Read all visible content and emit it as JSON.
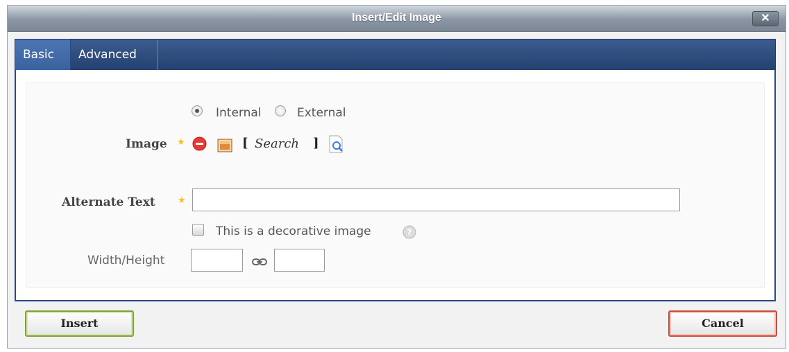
{
  "dialog": {
    "title": "Insert/Edit Image",
    "close_label": "✕"
  },
  "tabs": [
    {
      "label": "Basic",
      "active": true
    },
    {
      "label": "Advanced",
      "active": false
    }
  ],
  "form": {
    "source": {
      "options": [
        {
          "label": "Internal",
          "checked": true
        },
        {
          "label": "External",
          "checked": false
        }
      ]
    },
    "image": {
      "label": "Image",
      "required_mark": "★",
      "bracket_open": "[",
      "search_link": "Search",
      "bracket_close": "]"
    },
    "alt_text": {
      "label": "Alternate Text",
      "required_mark": "★",
      "value": ""
    },
    "decorative": {
      "label": "This is a decorative image",
      "checked": false
    },
    "dimensions": {
      "label": "Width/Height",
      "width_value": "",
      "height_value": ""
    }
  },
  "buttons": {
    "insert_label": "Insert",
    "cancel_label": "Cancel"
  },
  "colors": {
    "tab_bar": "#24416f",
    "insert_border": "#7da03a",
    "cancel_border": "#cc4a3a",
    "required_star": "#f0c419",
    "remove_icon": "#e53935"
  }
}
